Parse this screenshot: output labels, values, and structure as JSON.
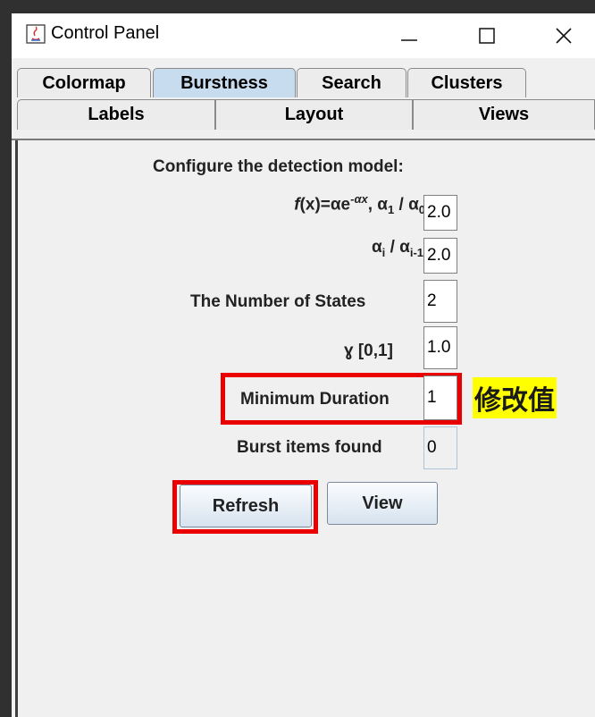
{
  "window": {
    "title": "Control Panel"
  },
  "tabs_row1": [
    "Colormap",
    "Burstness",
    "Search",
    "Clusters"
  ],
  "tabs_row2": [
    "Labels",
    "Layout",
    "Views"
  ],
  "selected_tab": "Burstness",
  "form": {
    "heading": "Configure the detection model:",
    "formula_ratio_value": "2.0",
    "ratio_value": "2.0",
    "num_states_label": "The Number of States",
    "num_states_value": "2",
    "gamma_label": "ɣ [0,1]",
    "gamma_value": "1.0",
    "min_duration_label": "Minimum Duration",
    "min_duration_value": "1",
    "burst_found_label": "Burst items found",
    "burst_found_value": "0"
  },
  "buttons": {
    "refresh": "Refresh",
    "view": "View"
  },
  "annotation": "修改值",
  "colors": {
    "highlight": "#ea0000",
    "note_bg": "#ffff00",
    "selected_tab": "#c8dcf0"
  },
  "icons": [
    "java-app-icon",
    "minimize-icon",
    "maximize-icon",
    "close-icon"
  ]
}
